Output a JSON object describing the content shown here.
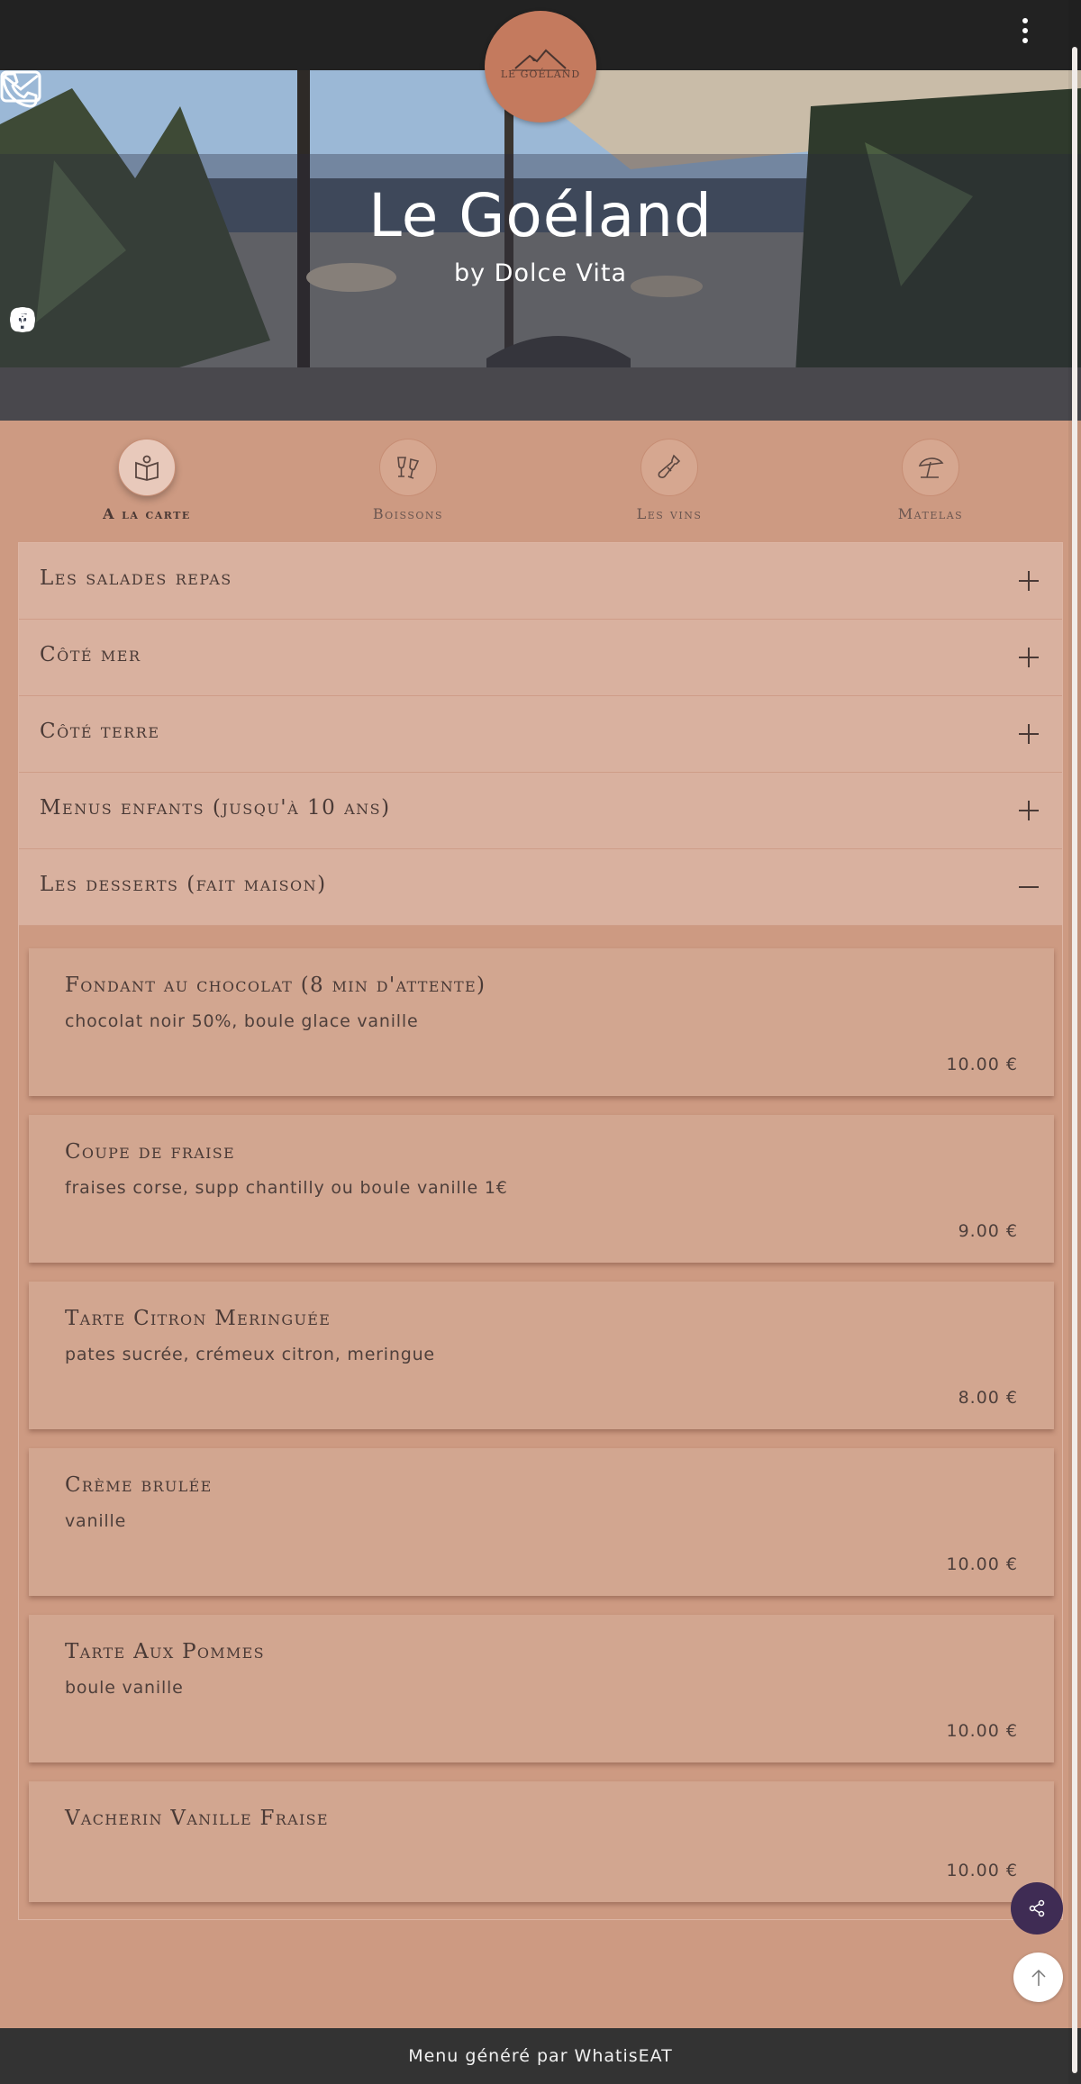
{
  "header": {
    "menu_icon": "kebab-menu-icon"
  },
  "logo": {
    "text": "LE GOÉLAND"
  },
  "hero": {
    "title": "Le Goéland",
    "subtitle": "by Dolce Vita",
    "social_icons": [
      "facebook-icon",
      "tripadvisor-icon",
      "instagram-icon"
    ],
    "contact_icons": [
      "mail-icon",
      "phone-icon"
    ]
  },
  "categories": [
    {
      "label": "A la carte",
      "icon": "menu-book-icon",
      "active": true
    },
    {
      "label": "Boissons",
      "icon": "cocktail-glasses-icon",
      "active": false
    },
    {
      "label": "Les vins",
      "icon": "wine-bottle-icon",
      "active": false
    },
    {
      "label": "Matelas",
      "icon": "beach-umbrella-icon",
      "active": false
    }
  ],
  "sections": [
    {
      "title": "Les salades repas",
      "state": "collapsed"
    },
    {
      "title": "Côté mer",
      "state": "collapsed"
    },
    {
      "title": "Côté terre",
      "state": "collapsed"
    },
    {
      "title": "Menus enfants (jusqu'à 10 ans)",
      "state": "collapsed"
    },
    {
      "title": "Les desserts (fait maison)",
      "state": "expanded"
    }
  ],
  "desserts": [
    {
      "name": "Fondant au chocolat (8 min d'attente)",
      "description": "chocolat noir 50%, boule glace vanille",
      "price": "10.00 €"
    },
    {
      "name": "Coupe de fraise",
      "description": "fraises corse, supp chantilly ou boule vanille 1€",
      "price": "9.00 €"
    },
    {
      "name": "Tarte Citron Meringuée",
      "description": "pates sucrée, crémeux citron, meringue",
      "price": "8.00 €"
    },
    {
      "name": "Crème brulée",
      "description": "vanille",
      "price": "10.00 €"
    },
    {
      "name": "Tarte Aux Pommes",
      "description": "boule vanille",
      "price": "10.00 €"
    },
    {
      "name": "Vacherin Vanille Fraise",
      "description": "",
      "price": "10.00 €"
    }
  ],
  "floating": {
    "share_icon": "share-icon",
    "top_icon": "arrow-up-icon"
  },
  "footer": {
    "text": "Menu généré par WhatisEAT"
  },
  "colors": {
    "background": "#cd9a82",
    "accent": "#c47a5e",
    "share_button": "#3f2c54",
    "footer": "#333333",
    "topbar": "#222222"
  }
}
